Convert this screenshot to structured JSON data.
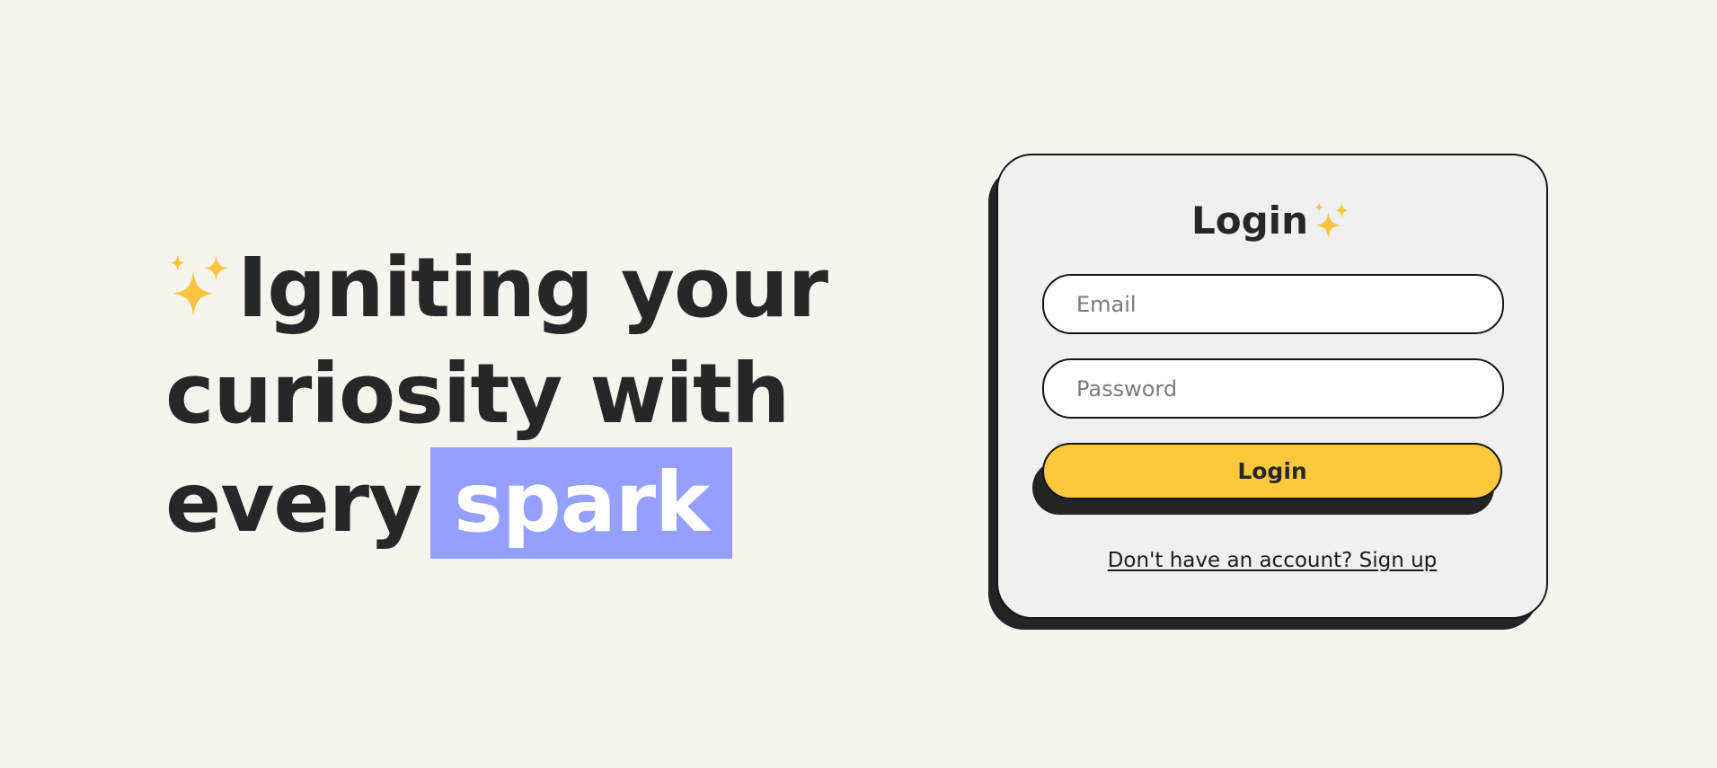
{
  "hero": {
    "line1": "Igniting your",
    "line2": "curiosity with",
    "line3_prefix": "every",
    "highlight_word": "spark",
    "highlight_color": "#95a0fe",
    "icon": "sparkles-icon"
  },
  "login_card": {
    "title": "Login",
    "title_icon": "sparkles-icon",
    "email_placeholder": "Email",
    "email_value": "",
    "password_placeholder": "Password",
    "password_value": "",
    "submit_label": "Login",
    "signup_text": "Don't have an account? Sign up"
  },
  "colors": {
    "background": "#f7f4ee",
    "card_background": "#f0f0f0",
    "button_yellow": "#fdc83b",
    "sparkle_yellow": "#fbc43c",
    "text_dark": "#27272a",
    "shadow": "#232427"
  }
}
